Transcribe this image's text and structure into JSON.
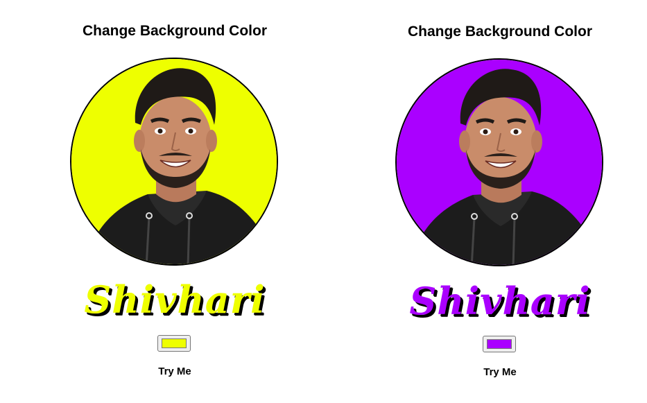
{
  "panels": [
    {
      "title": "Change Background Color",
      "name_text": "Shivhari",
      "color": "#eeff00",
      "button_label": "Try Me"
    },
    {
      "title": "Change Background Color",
      "name_text": "Shivhari",
      "color": "#aa00ff",
      "button_label": "Try Me"
    }
  ],
  "icons": {
    "avatar": "person-photo"
  }
}
